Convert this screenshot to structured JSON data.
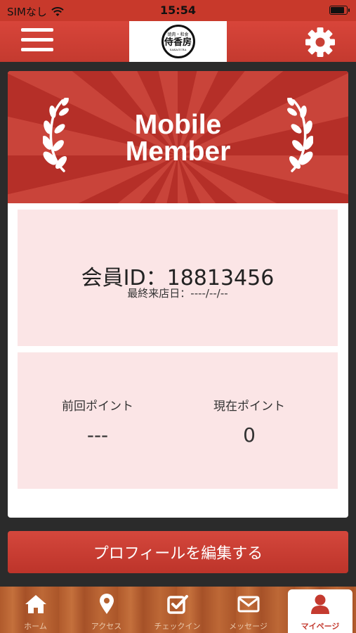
{
  "status_bar": {
    "carrier": "SIMなし",
    "time": "15:54"
  },
  "header": {
    "logo_top": "焼肉・和食",
    "logo_main": "侍香房",
    "logo_sub": "SAKAGURA"
  },
  "banner": {
    "title_line1": "Mobile",
    "title_line2": "Member"
  },
  "member": {
    "id_text": "会員ID：18813456",
    "last_visit": "最終来店日：----/--/--"
  },
  "points": {
    "previous_label": "前回ポイント",
    "previous_value": "---",
    "current_label": "現在ポイント",
    "current_value": "0"
  },
  "edit_button_label": "プロフィールを編集する",
  "tabs": [
    {
      "label": "ホーム",
      "icon": "home-icon"
    },
    {
      "label": "アクセス",
      "icon": "map-pin-icon"
    },
    {
      "label": "チェックイン",
      "icon": "checkbox-icon"
    },
    {
      "label": "メッセージ",
      "icon": "envelope-icon"
    },
    {
      "label": "マイページ",
      "icon": "user-icon"
    }
  ],
  "colors": {
    "brand_red": "#c43a2f",
    "panel_pink": "#fbe5e6"
  }
}
